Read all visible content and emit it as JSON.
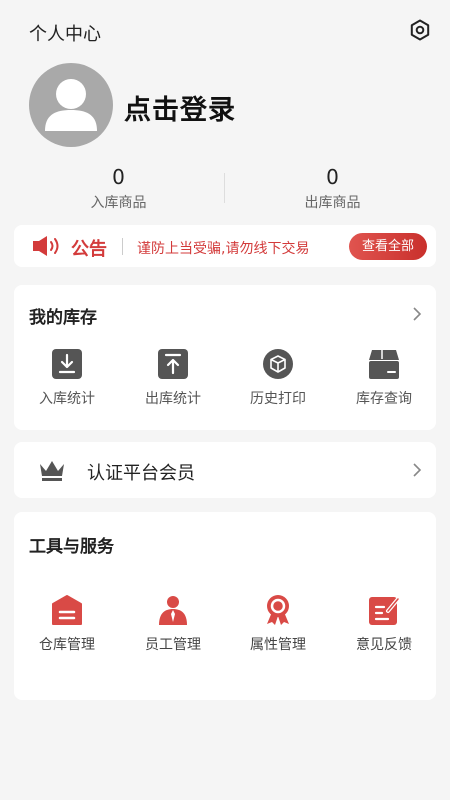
{
  "header": {
    "title": "个人中心",
    "settings_icon": "settings-icon"
  },
  "profile": {
    "login_text": "点击登录",
    "avatar_icon": "user-icon"
  },
  "stats": [
    {
      "value": "0",
      "label": "入库商品"
    },
    {
      "value": "0",
      "label": "出库商品"
    }
  ],
  "notice": {
    "title": "公告",
    "text": "谨防上当受骗,请勿线下交易",
    "button": "查看全部",
    "icon": "megaphone-icon",
    "color": "#d33b3b"
  },
  "inventory": {
    "title": "我的库存",
    "items": [
      {
        "label": "入库统计",
        "icon": "inbound-icon"
      },
      {
        "label": "出库统计",
        "icon": "outbound-icon"
      },
      {
        "label": "历史打印",
        "icon": "history-print-icon"
      },
      {
        "label": "库存查询",
        "icon": "stock-query-icon"
      }
    ]
  },
  "member": {
    "label": "认证平台会员",
    "icon": "crown-icon"
  },
  "tools": {
    "title": "工具与服务",
    "items": [
      {
        "label": "仓库管理",
        "icon": "warehouse-icon"
      },
      {
        "label": "员工管理",
        "icon": "staff-icon"
      },
      {
        "label": "属性管理",
        "icon": "attribute-icon"
      },
      {
        "label": "意见反馈",
        "icon": "feedback-icon"
      }
    ]
  },
  "colors": {
    "accent": "#d94a46",
    "icon_gray": "#555555",
    "background": "#f5f5f5"
  }
}
